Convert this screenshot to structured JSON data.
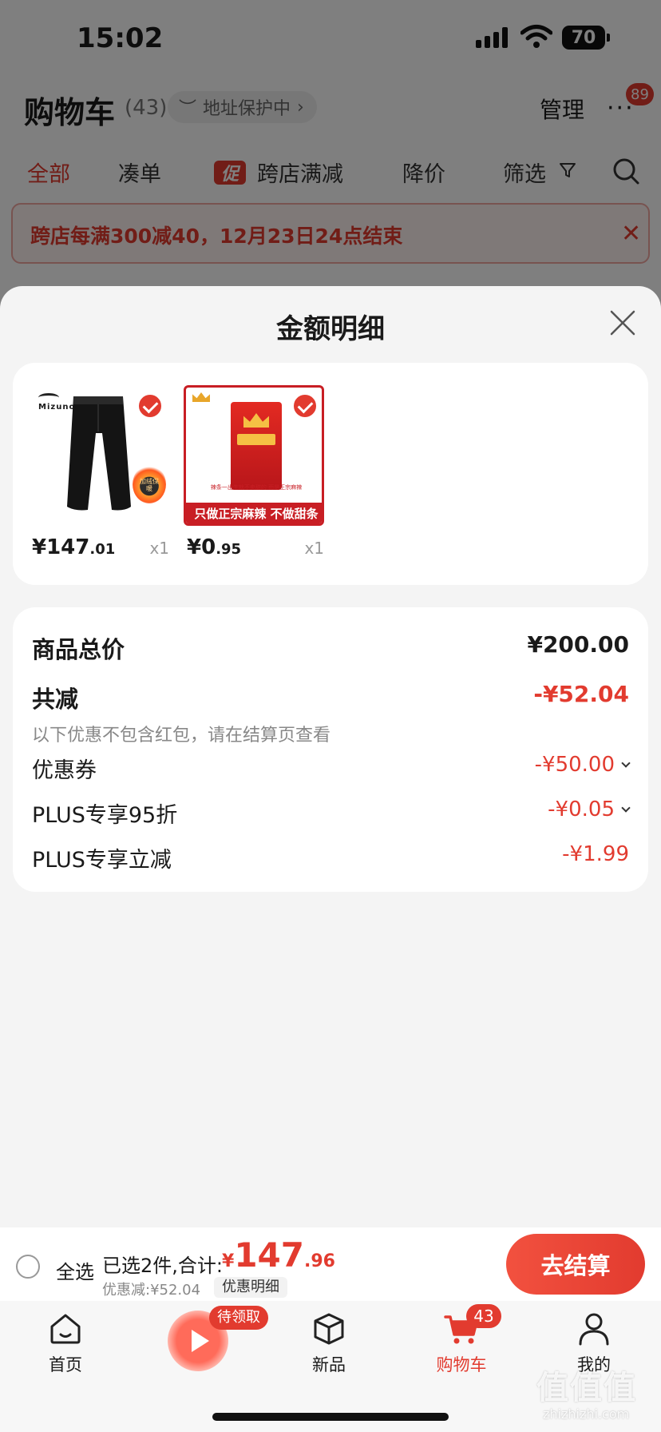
{
  "status_bar": {
    "time": "15:02",
    "battery": "70"
  },
  "cart_header": {
    "title": "购物车",
    "count": "(43)",
    "address_chip": "地址保护中",
    "manage": "管理",
    "message_badge": "89"
  },
  "cart_tabs": {
    "all": "全部",
    "combine": "凑单",
    "promo_tag": "促",
    "cross_store": "跨店满减",
    "price_drop": "降价",
    "filter": "筛选"
  },
  "promo_banner": {
    "text": "跨店每满300减40，12月23日24点结束"
  },
  "sheet": {
    "title": "金额明细",
    "items": [
      {
        "price_int": "¥147",
        "price_dec": ".01",
        "qty": "x1",
        "logo": "Mizuno",
        "badge": "加绒保暖"
      },
      {
        "price_int": "¥0",
        "price_dec": ".95",
        "qty": "x1",
        "strip": "辣条一出生就不卖甜的 而是正宗麻辣",
        "banner": "只做正宗麻辣 不做甜条"
      }
    ],
    "total_label": "商品总价",
    "total_value": "¥200.00",
    "reduction_label": "共减",
    "reduction_value": "-¥52.04",
    "reduction_note": "以下优惠不包含红包，请在结算页查看",
    "discounts": [
      {
        "label": "优惠券",
        "value": "-¥50.00"
      },
      {
        "label": "PLUS专享95折",
        "value": "-¥0.05"
      },
      {
        "label": "PLUS专享立减",
        "value": "-¥1.99"
      }
    ]
  },
  "checkout": {
    "select_all": "全选",
    "selected_summary": "已选2件,合计:",
    "total_currency": "¥",
    "total_int": "147",
    "total_dec": ".96",
    "discount_line": "优惠减:¥52.04",
    "detail_chip": "优惠明细",
    "checkout_button": "去结算"
  },
  "tab_bar": {
    "home": "首页",
    "pending": "待领取",
    "new": "新品",
    "cart": "购物车",
    "cart_badge": "43",
    "me": "我的"
  },
  "watermark": {
    "main": "值值值",
    "sub": "zhizhizhi.com"
  },
  "colors": {
    "accent": "#e23b2f",
    "background": "#f4f4f4",
    "card": "#ffffff"
  }
}
